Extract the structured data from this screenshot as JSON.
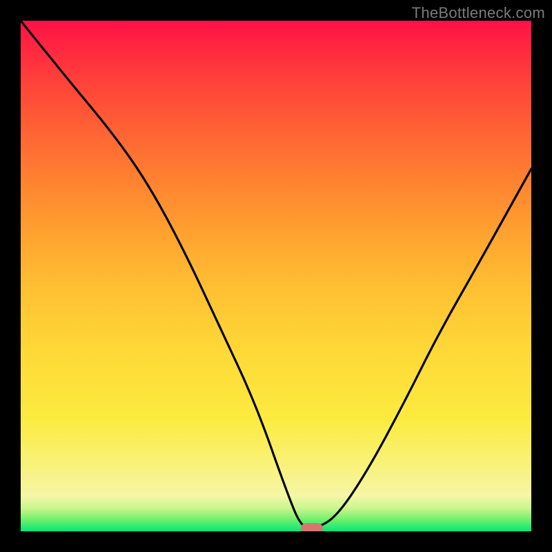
{
  "watermark": "TheBottleneck.com",
  "chart_data": {
    "type": "line",
    "title": "",
    "xlabel": "",
    "ylabel": "",
    "xlim": [
      0,
      100
    ],
    "ylim": [
      0,
      100
    ],
    "grid": false,
    "legend": null,
    "marker": {
      "x": 57,
      "y": 0.5
    },
    "series": [
      {
        "name": "bottleneck-curve",
        "x": [
          0,
          8,
          18,
          25,
          32,
          39,
          46,
          52,
          55,
          58,
          62,
          68,
          75,
          82,
          90,
          100
        ],
        "y": [
          100,
          90,
          78,
          68,
          55,
          40,
          25,
          8,
          0.6,
          0.6,
          3,
          12,
          25,
          39,
          53,
          71
        ]
      }
    ],
    "background_gradient": {
      "direction": "vertical",
      "stops": [
        {
          "pos": 0.0,
          "color": "#00e977"
        },
        {
          "pos": 0.02,
          "color": "#6bef6b"
        },
        {
          "pos": 0.05,
          "color": "#caf58e"
        },
        {
          "pos": 0.07,
          "color": "#f6f6a6"
        },
        {
          "pos": 0.13,
          "color": "#f8f27a"
        },
        {
          "pos": 0.22,
          "color": "#fceb3f"
        },
        {
          "pos": 0.35,
          "color": "#fed937"
        },
        {
          "pos": 0.48,
          "color": "#ffbf32"
        },
        {
          "pos": 0.58,
          "color": "#ffa32f"
        },
        {
          "pos": 0.68,
          "color": "#ff8430"
        },
        {
          "pos": 0.78,
          "color": "#ff6434"
        },
        {
          "pos": 0.88,
          "color": "#ff4239"
        },
        {
          "pos": 0.98,
          "color": "#ff1a44"
        },
        {
          "pos": 1.0,
          "color": "#ff0f4b"
        }
      ]
    }
  }
}
